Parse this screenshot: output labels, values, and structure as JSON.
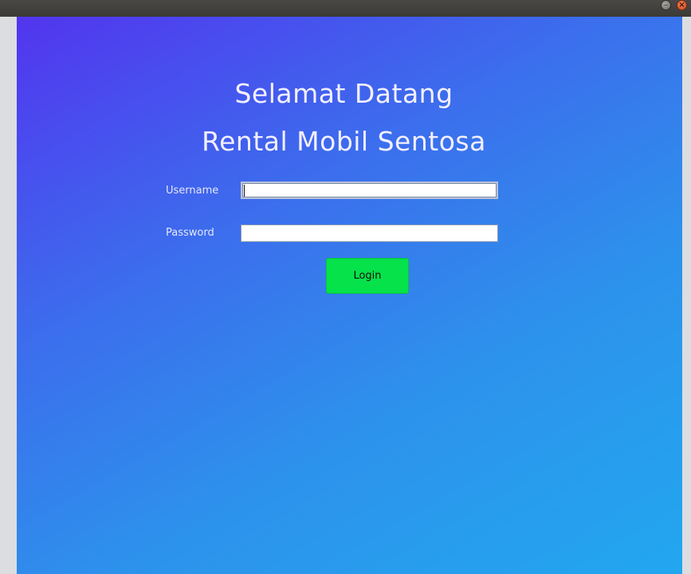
{
  "window": {
    "minimize_glyph": "–",
    "close_glyph": "×"
  },
  "heading": {
    "line1": "Selamat Datang",
    "line2": "Rental Mobil Sentosa"
  },
  "form": {
    "username_label": "Username",
    "username_value": "",
    "password_label": "Password",
    "password_value": "",
    "login_label": "Login"
  },
  "colors": {
    "gradient_start": "#5235ee",
    "gradient_end": "#22a7ef",
    "login_button": "#06e24a",
    "text_light": "#f3efff"
  },
  "icons": [
    "minimize-icon",
    "close-icon"
  ]
}
